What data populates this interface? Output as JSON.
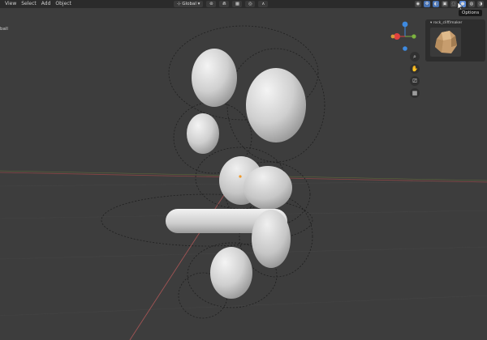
{
  "header": {
    "menu": [
      "View",
      "Select",
      "Add",
      "Object"
    ],
    "transform_orientation": "Global",
    "tooltip": "Options"
  },
  "left_label": "ball",
  "asset_panel": {
    "title": "rock_cliff/maker"
  },
  "gizmo": {
    "x_color": "#e0413e",
    "y_color": "#7cb33f",
    "z_color": "#3e8ae0",
    "neg_x_color": "#d59b3a"
  },
  "colors": {
    "background": "#3d3d3d",
    "header": "#2b2b2b",
    "accent": "#4772b3",
    "x_axis": "#9b4a4a",
    "y_axis": "#6a7a3a",
    "grid": "#454545",
    "object": "#dcdcdc"
  }
}
